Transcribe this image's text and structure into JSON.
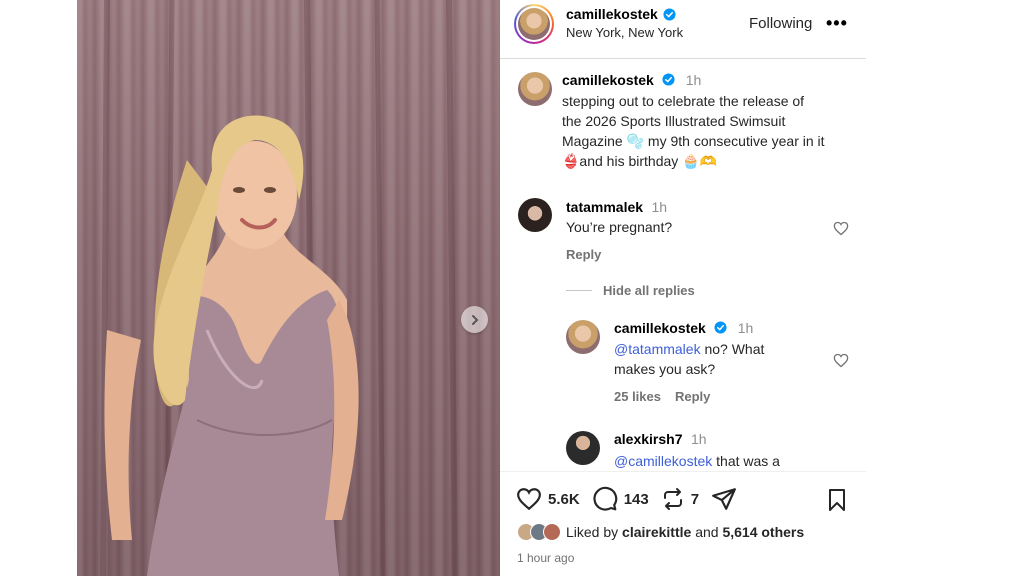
{
  "post": {
    "author": "camillekostek",
    "location": "New York, New York",
    "follow_state": "Following",
    "more_glyph": "•••"
  },
  "caption": {
    "author": "camillekostek",
    "time": "1h",
    "line1": "stepping out to celebrate the release of",
    "line2": "the 2026 Sports Illustrated Swimsuit",
    "line3": "Magazine 🫧 my 9th consecutive year in it",
    "line4": "👙and his birthday 🧁🫶"
  },
  "comments": [
    {
      "author": "tatammalek",
      "time": "1h",
      "text": "You’re pregnant?",
      "reply_label": "Reply",
      "hide_replies_label": "Hide all replies"
    }
  ],
  "replies": [
    {
      "author": "camillekostek",
      "time": "1h",
      "mention": "@tatammalek",
      "text_a": " no? What",
      "text_b": "makes you ask?",
      "likes": "25 likes",
      "reply_label": "Reply"
    },
    {
      "author": "alexkirsh7",
      "time": "1h",
      "mention": "@camillekostek",
      "text_a": " that was a"
    }
  ],
  "actions": {
    "like_count": "5.6K",
    "comment_count": "143",
    "repost_count": "7"
  },
  "likes_summary": {
    "prefix": "Liked by ",
    "user": "clairekittle",
    "middle": " and ",
    "others": "5,614 others"
  },
  "post_time": "1 hour ago",
  "colors": {
    "verified": "#0095f6",
    "mention": "#3d5fd6",
    "curtain": "#8a6a70",
    "dress": "#a78a95"
  }
}
